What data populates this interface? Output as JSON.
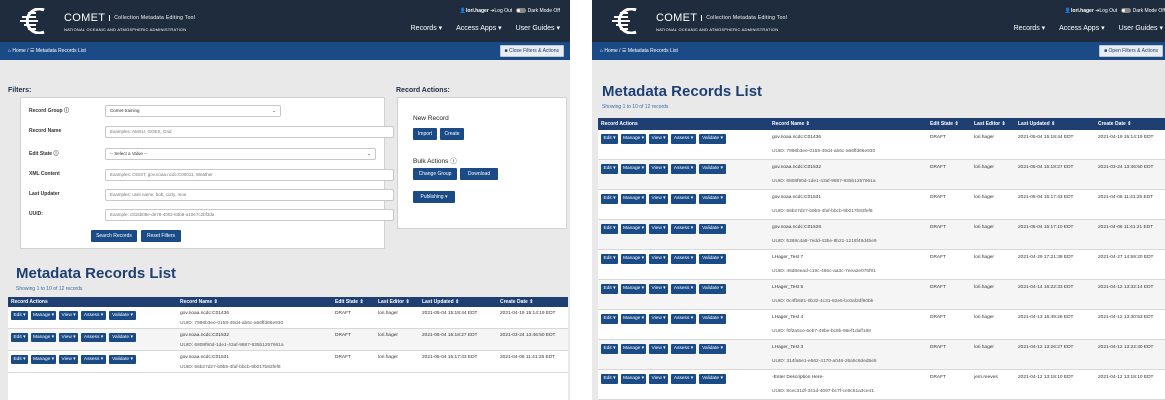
{
  "header": {
    "app_name": "COMET",
    "app_subtitle": "Collection Metadata Editing Tool",
    "org": "NATIONAL OCEANIC AND ATMOSPHERIC ADMINISTRATION",
    "user": "lori.hager",
    "logout": "Log Out",
    "dark_mode": "Dark Mode Off",
    "menu": [
      "Records",
      "Access Apps",
      "User Guides"
    ]
  },
  "breadcrumb": {
    "home": "Home",
    "separator": "/",
    "current": "Metadata Records List"
  },
  "left": {
    "toggle_button": "Close Filters & Actions",
    "filters": {
      "title": "Filters:",
      "fields": [
        {
          "label": "Record Group",
          "value": "Comet-training",
          "kind": "select",
          "info": true
        },
        {
          "label": "Record Name",
          "placeholder": "Examples: AMSU, GOES, Grid",
          "kind": "input"
        },
        {
          "label": "Edit State",
          "value": "-- Select a Value --",
          "kind": "select",
          "info": true
        },
        {
          "label": "XML Content",
          "placeholder": "Examples: OISST, gov.noaa.ncdc:C00011, Weather",
          "kind": "input"
        },
        {
          "label": "Last Updater",
          "placeholder": "Examples: user.name, bob, curly, moe",
          "kind": "input"
        },
        {
          "label": "UUID:",
          "placeholder": "Example: c815b08e-de78-4002-83b8-a10e7c2bf3da",
          "kind": "input"
        }
      ],
      "search_button": "Search Records",
      "reset_button": "Reset Filters"
    },
    "actions": {
      "title": "Record Actions:",
      "new_record": "New Record",
      "import": "Import",
      "create": "Create",
      "bulk_actions": "Bulk Actions",
      "change_group": "Change Group",
      "download": "Download",
      "publishing": "Publishing"
    }
  },
  "right": {
    "toggle_button": "Open Filters & Actions"
  },
  "list": {
    "title": "Metadata Records List",
    "showing": "Showing 1 to 10 of 12 records",
    "columns": [
      "Record Actions",
      "Record Name",
      "Edit State",
      "Last Editor",
      "Last Updated",
      "Create Date"
    ],
    "sort_glyph": "⇕",
    "action_buttons": [
      "Edit",
      "Manage",
      "View",
      "Assess",
      "Validate"
    ],
    "uuid_prefix": "UUID: ",
    "rows": [
      {
        "name": "gov.noaa.ncdc:C01436",
        "state": "DRAFT",
        "editor": "lori.hager",
        "updated": "2021-05-04 15:18:44 EDT",
        "created": "2021-04-19 15:14:19 EDT",
        "uuid": "7998b3ee-0158-49d4-ab6c-a66ffd66e930"
      },
      {
        "name": "gov.noaa.ncdc:C01532",
        "state": "DRAFT",
        "editor": "lori.hager",
        "updated": "2021-05-04 15:18:27 EDT",
        "created": "2021-03-24 13:46:50 EDT",
        "uuid": "6808f90d-1de1-43af-9887-935b1257661a"
      },
      {
        "name": "gov.noaa.ncdc:C01531",
        "state": "DRAFT",
        "editor": "lori.hager",
        "updated": "2021-05-04 15:17:43 EDT",
        "created": "2021-04-06 11:41:25 EDT",
        "uuid": "66b27d27-b9b5-4faf-bbcb-9b017b83fef8"
      },
      {
        "name": "gov.noaa.ncdc:C01528",
        "state": "DRAFT",
        "editor": "lori.hager",
        "updated": "2021-05-04 15:17:10 EDT",
        "created": "2021-04-06 11:41:21 EDT",
        "uuid": "5369c4a8-7edd-43be-8b21-1218f48d4be9"
      },
      {
        "name": "LHager_Test 7",
        "state": "DRAFT",
        "editor": "lori.hager",
        "updated": "2021-04-29 17:21:39 EDT",
        "created": "2021-04-27 14:59:20 EDT",
        "uuid": "46d8eead-c19c-465c-aa3c-7eea2e076f91"
      },
      {
        "name": "LHager_Test 5",
        "state": "DRAFT",
        "editor": "lori.hager",
        "updated": "2021-04-14 16:22:33 EDT",
        "created": "2021-04-12 13:32:14 EDT",
        "uuid": "0c4fb581-0b32-4c31-82e5-bc0af2df90bb"
      },
      {
        "name": "LHager_Test 4",
        "state": "DRAFT",
        "editor": "lori.hager",
        "updated": "2021-04-13 16:49:26 EDT",
        "created": "2021-04-12 13:30:53 EDT",
        "uuid": "f0f2a5ce-6eb7-49be-bc8b-96ef1daff188"
      },
      {
        "name": "LHager_Test 3",
        "state": "DRAFT",
        "editor": "lori.hager",
        "updated": "2021-04-12 13:26:27 EDT",
        "created": "2021-04-12 13:22:30 EDT",
        "uuid": "314fa5e1-e562-4170-a046-26a5c6ded5e5"
      },
      {
        "name": "-Enter Description Here-",
        "state": "DRAFT",
        "editor": "jerri.reeves",
        "updated": "2021-04-12 13:18:10 EDT",
        "created": "2021-04-12 13:18:10 EDT",
        "uuid": "8cec31df-341d-4097-bc7f-ce5c61a3ce41"
      }
    ]
  },
  "colors": {
    "navbar": "#1f2c3e",
    "breadcrumb_bar": "#1a4b87",
    "button": "#1a4b87",
    "table_header": "#1f3f73",
    "title_text": "#1f3f73"
  }
}
